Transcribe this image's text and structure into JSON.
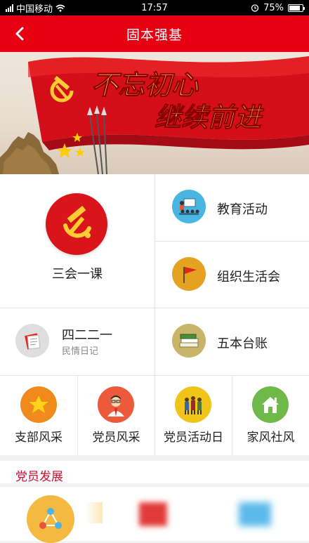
{
  "status": {
    "carrier": "中国移动",
    "time": "17:57",
    "battery": "75%"
  },
  "nav": {
    "title": "固本强基"
  },
  "banner": {
    "line1": "不忘初心",
    "line2": "继续前进"
  },
  "menu": {
    "sanhui": "三会一课",
    "jiaoyu": "教育活动",
    "zuzhi": "组织生活会",
    "siererer": "四二二一",
    "siererer_sub": "民情日记",
    "wuben": "五本台账",
    "zhibu": "支部风采",
    "dangyuan": "党员风采",
    "huodongri": "党员活动日",
    "jiafeng": "家风社风"
  },
  "section": {
    "title": "党员发展"
  },
  "colors": {
    "brand_red": "#e60012",
    "section_red": "#c8102e"
  }
}
